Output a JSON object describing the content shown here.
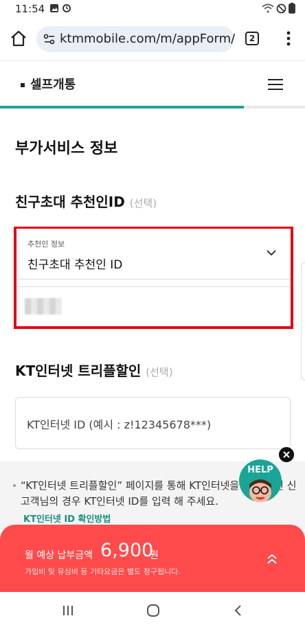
{
  "status_bar": {
    "time": "11:54",
    "left_icons": [
      "gallery-icon",
      "sync-icon"
    ],
    "right_icons": [
      "wifi-icon",
      "do-not-disturb-icon",
      "battery-icon"
    ]
  },
  "browser": {
    "url": "ktmmobile.com/m/appForm/",
    "tab_count": "2",
    "icons": [
      "home-icon",
      "site-settings-icon",
      "tabs-icon",
      "more-menu-icon"
    ]
  },
  "site_header": {
    "title": "셀프개통",
    "progress_fraction": 0.8,
    "accent_color": "#1aa596"
  },
  "page": {
    "section_title": "부가서비스 정보",
    "referral": {
      "title": "친구초대 추천인ID",
      "optional": "(선택)",
      "select_label": "추천인 정보",
      "select_value": "친구초대 추천인 ID"
    },
    "kt_internet": {
      "title": "KT인터넷 트리플할인",
      "optional": "(선택)",
      "placeholder": "KT인터넷 ID (예시 : z!12345678***)"
    }
  },
  "notice": {
    "line1": "“KT인터넷 트리플할인” 페이지를 통해 KT인터넷을 이용 중인 신",
    "line2": "고객님의 경우 KT인터넷 ID를 입력 해 주세요.",
    "link": "KT인터넷 ID 확인방법"
  },
  "help": {
    "label": "HELP",
    "icons": [
      "close-icon",
      "help-character-icon"
    ]
  },
  "price_bar": {
    "label": "월 예상 납부금액",
    "amount": "6,900",
    "unit": "원",
    "note": "가입비 및 유심비 등 기타요금은 별도 청구됩니다.",
    "background_color": "#ff4b4b"
  },
  "nav_bar": {
    "icons": [
      "recent-apps-icon",
      "home-button-icon",
      "back-icon"
    ]
  },
  "highlight_color": "#e30613"
}
